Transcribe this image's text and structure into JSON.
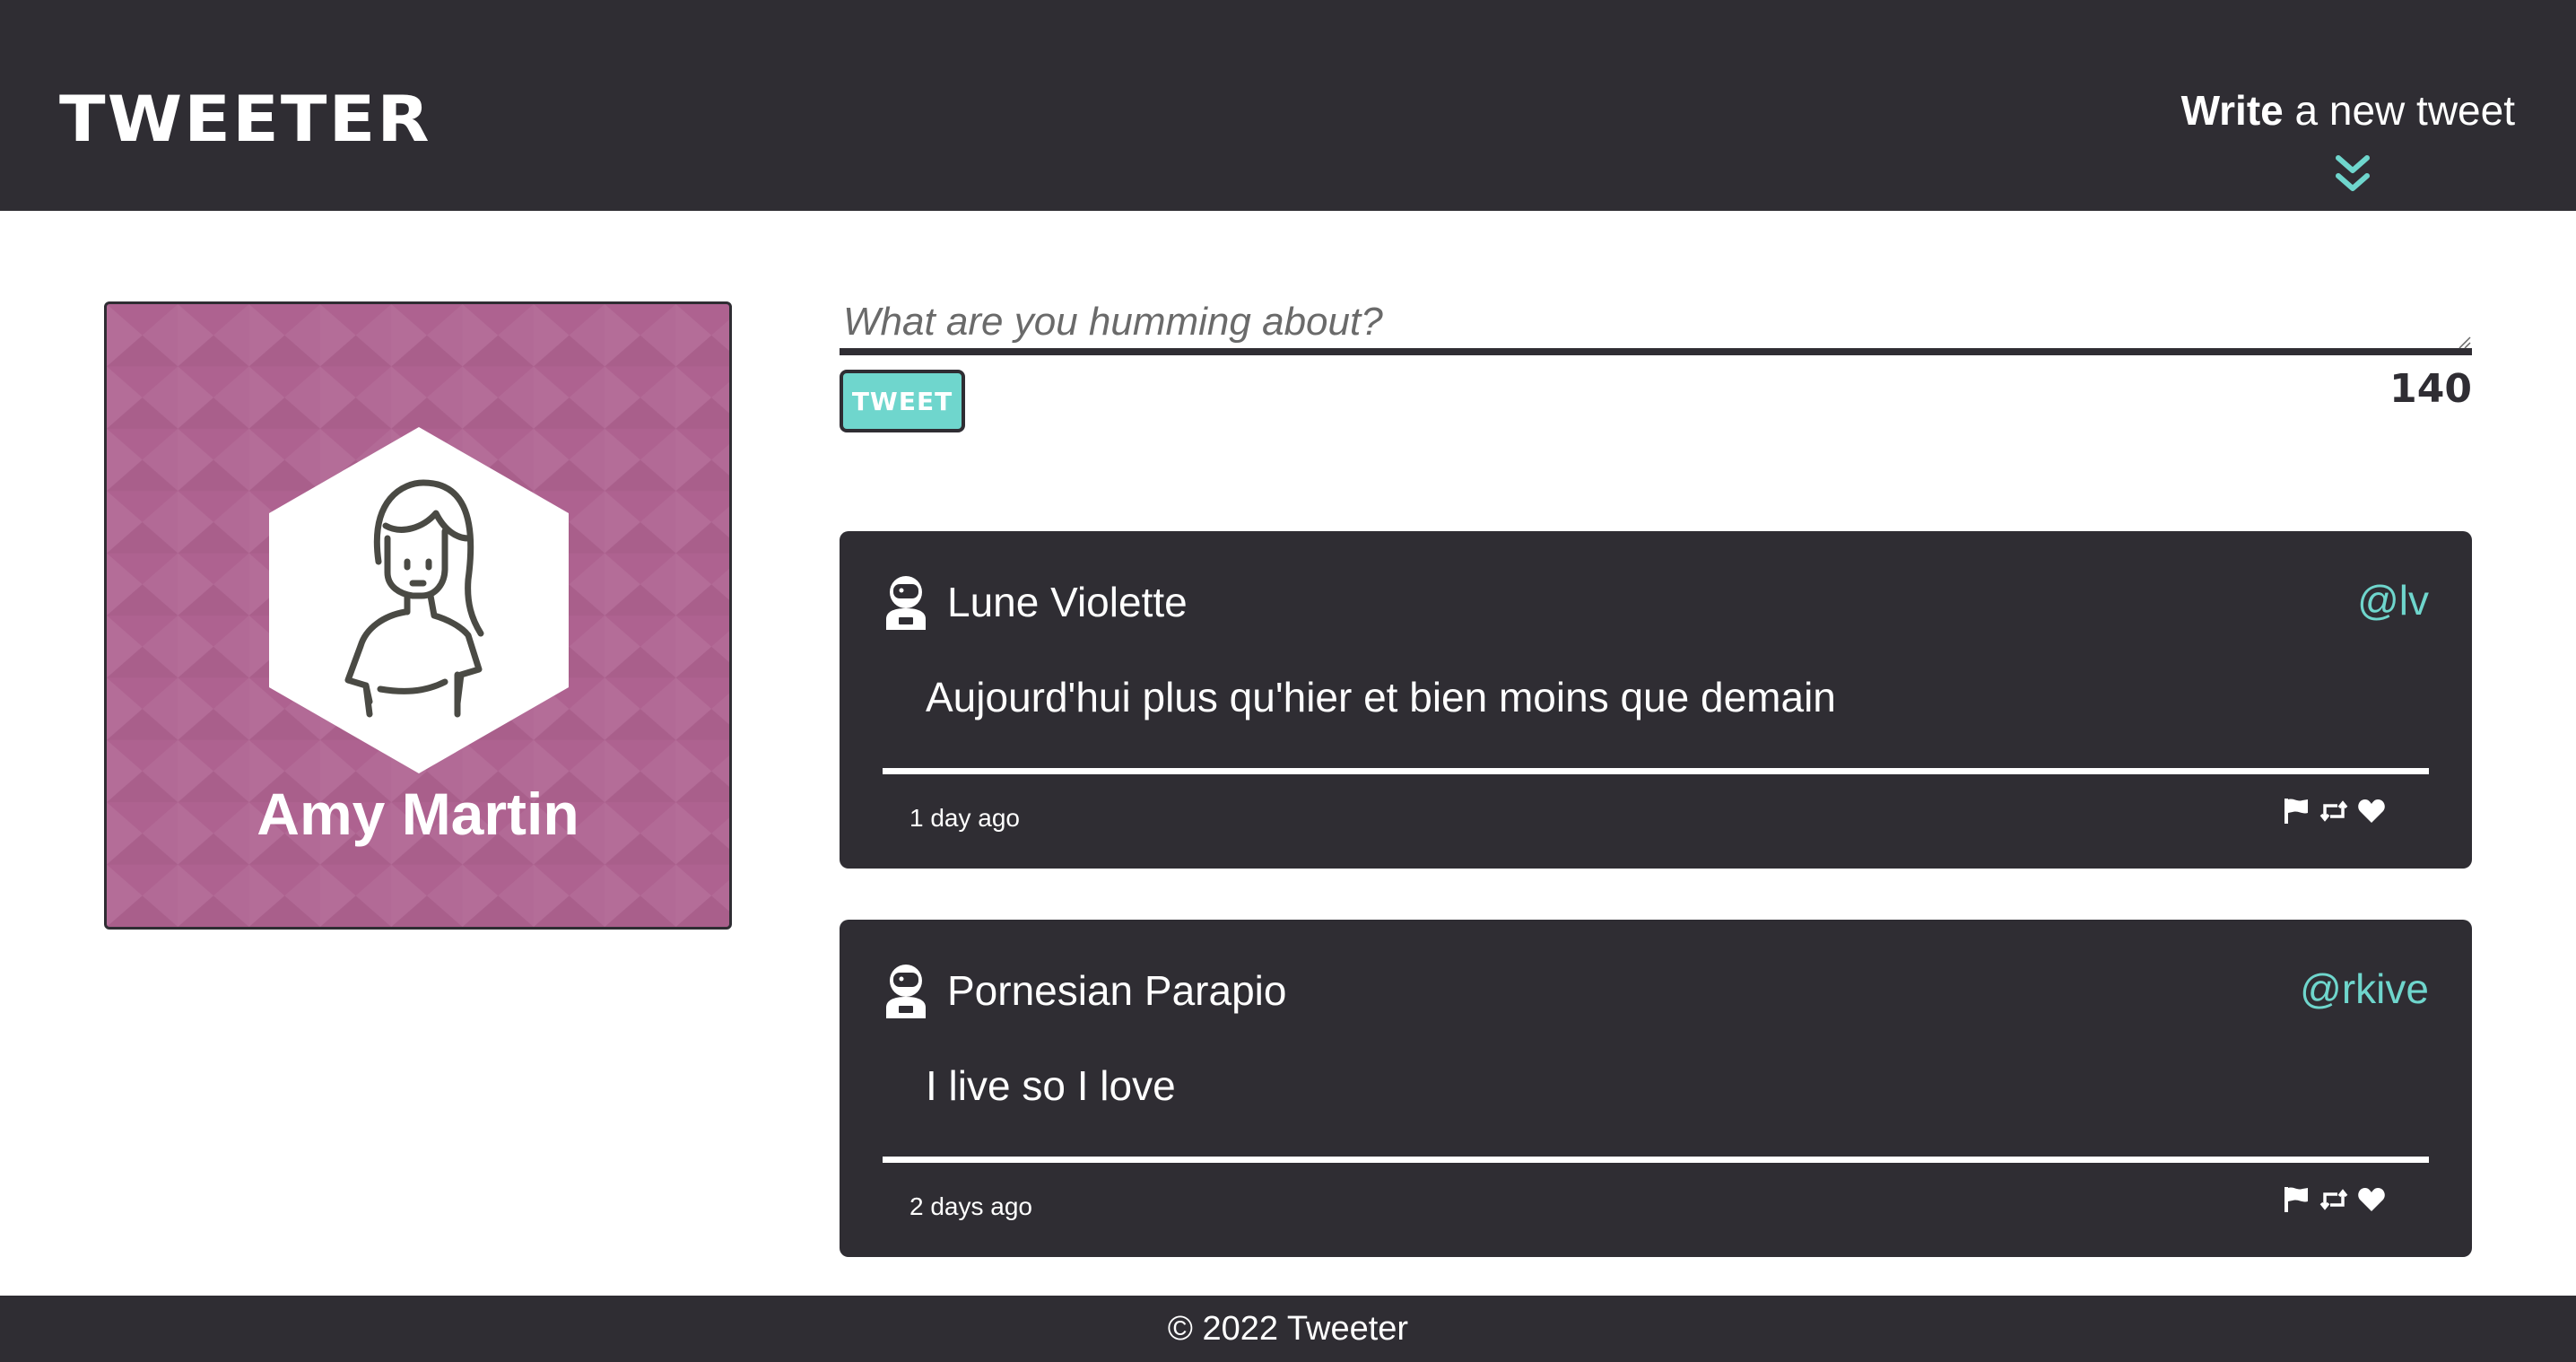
{
  "nav": {
    "brand": "TWEETER",
    "write_bold": "Write",
    "write_rest": " a new tweet"
  },
  "profile": {
    "name": "Amy Martin",
    "background_color": "#ae6290"
  },
  "compose": {
    "placeholder": "What are you humming about?",
    "button_label": "TWEET",
    "counter": "140"
  },
  "tweets": [
    {
      "name": "Lune Violette",
      "handle": "@lv",
      "text": "Aujourd'hui plus qu'hier et bien moins que demain",
      "time": "1 day ago",
      "icons": [
        "flag-icon",
        "retweet-icon",
        "heart-icon"
      ]
    },
    {
      "name": "Pornesian Parapio",
      "handle": "@rkive",
      "text": "I live so I love",
      "time": "2 days ago",
      "icons": [
        "flag-icon",
        "retweet-icon",
        "heart-icon"
      ]
    }
  ],
  "footer": {
    "text": "© 2022 Tweeter"
  },
  "colors": {
    "dark": "#2f2d33",
    "accent": "#6fd6cd",
    "profile": "#ae6290"
  }
}
